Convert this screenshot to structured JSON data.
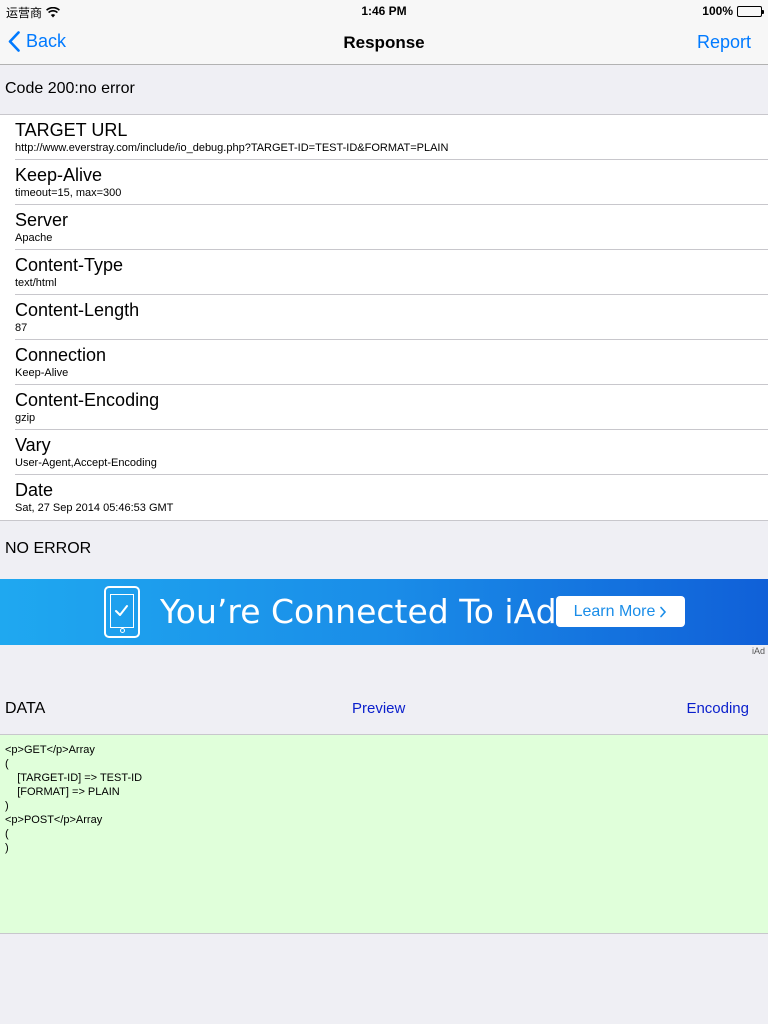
{
  "status_bar": {
    "carrier": "运营商",
    "time": "1:46 PM",
    "battery": "100%"
  },
  "nav": {
    "back_label": "Back",
    "title": "Response",
    "report_label": "Report"
  },
  "code_line": "Code 200:no error",
  "headers": [
    {
      "name": "TARGET URL",
      "value": "http://www.everstray.com/include/io_debug.php?TARGET-ID=TEST-ID&FORMAT=PLAIN"
    },
    {
      "name": "Keep-Alive",
      "value": "timeout=15, max=300"
    },
    {
      "name": "Server",
      "value": "Apache"
    },
    {
      "name": "Content-Type",
      "value": "text/html"
    },
    {
      "name": "Content-Length",
      "value": "87"
    },
    {
      "name": "Connection",
      "value": "Keep-Alive"
    },
    {
      "name": "Content-Encoding",
      "value": "gzip"
    },
    {
      "name": "Vary",
      "value": "User-Agent,Accept-Encoding"
    },
    {
      "name": "Date",
      "value": "Sat, 27 Sep 2014 05:46:53 GMT"
    }
  ],
  "error_line": "NO ERROR",
  "iad": {
    "text": "You’re Connected To iAd",
    "button_label": "Learn More",
    "label": "iAd"
  },
  "data_section": {
    "label": "DATA",
    "preview_label": "Preview",
    "encoding_label": "Encoding",
    "body": "<p>GET</p>Array\n(\n    [TARGET-ID] => TEST-ID\n    [FORMAT] => PLAIN\n)\n<p>POST</p>Array\n(\n)"
  },
  "colors": {
    "ios_blue": "#007aff",
    "link_blue": "#0a1fcc",
    "data_bg": "#e0ffda",
    "page_bg": "#efeff4"
  }
}
